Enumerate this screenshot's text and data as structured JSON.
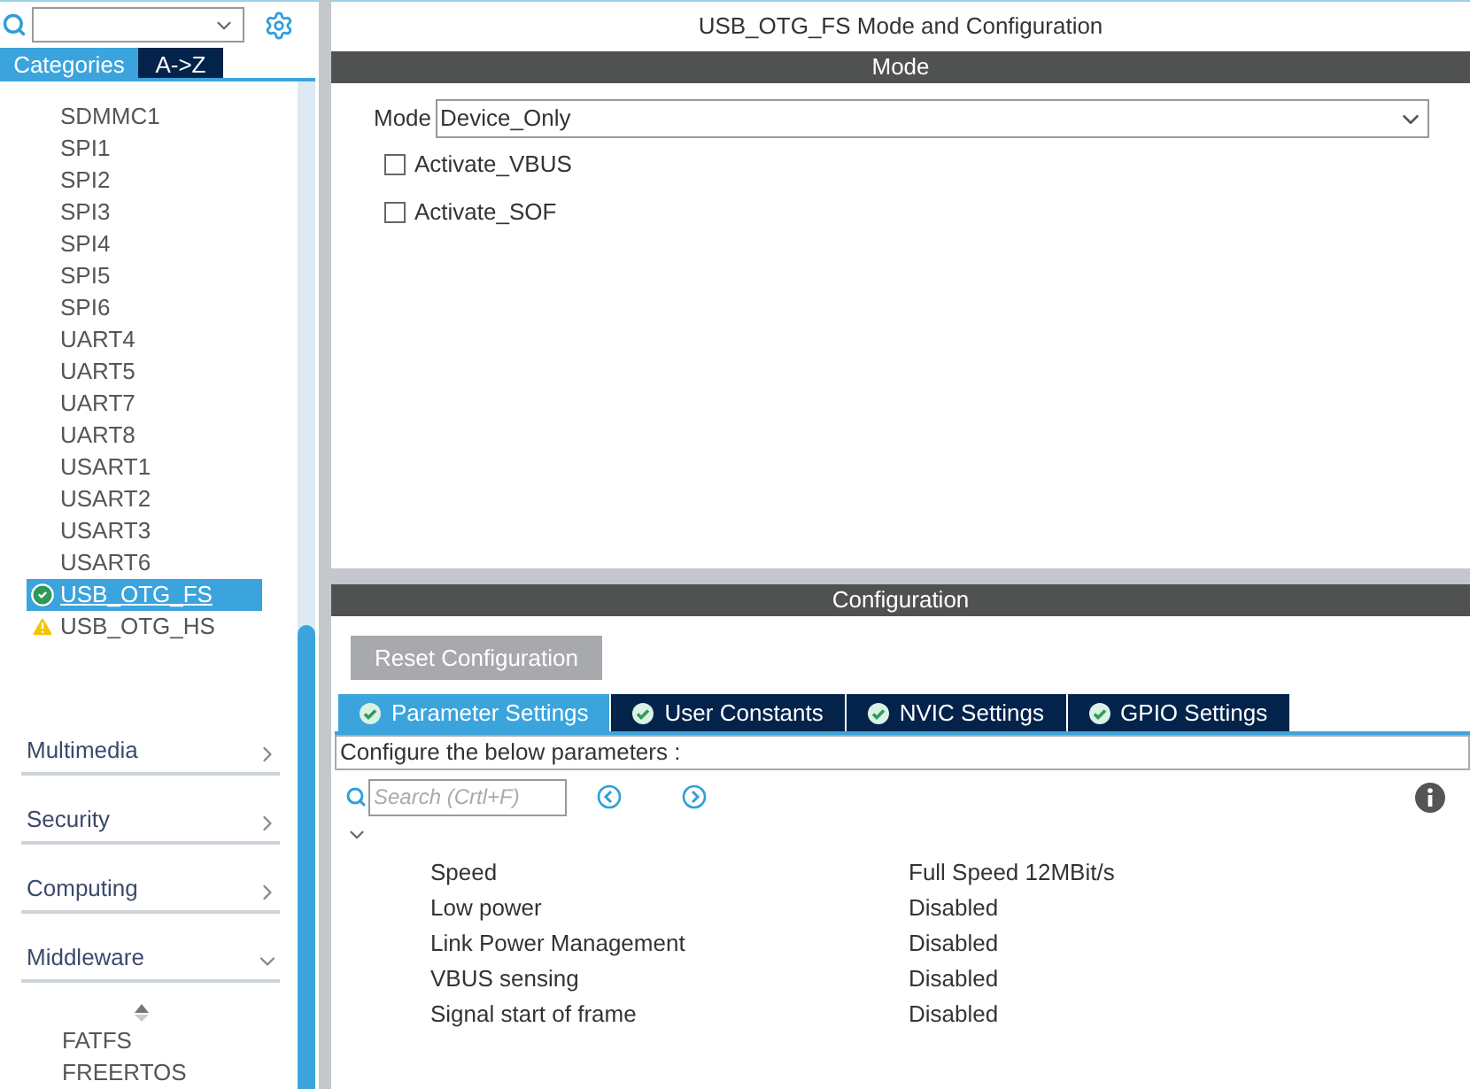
{
  "sidebar": {
    "view_tabs": [
      {
        "label": "Categories",
        "selected": true
      },
      {
        "label": "A->Z",
        "selected": false
      }
    ],
    "items": [
      {
        "label": "SDMMC1",
        "selected": false
      },
      {
        "label": "SPI1",
        "selected": false
      },
      {
        "label": "SPI2",
        "selected": false
      },
      {
        "label": "SPI3",
        "selected": false
      },
      {
        "label": "SPI4",
        "selected": false
      },
      {
        "label": "SPI5",
        "selected": false
      },
      {
        "label": "SPI6",
        "selected": false
      },
      {
        "label": "UART4",
        "selected": false
      },
      {
        "label": "UART5",
        "selected": false
      },
      {
        "label": "UART7",
        "selected": false
      },
      {
        "label": "UART8",
        "selected": false
      },
      {
        "label": "USART1",
        "selected": false
      },
      {
        "label": "USART2",
        "selected": false
      },
      {
        "label": "USART3",
        "selected": false
      },
      {
        "label": "USART6",
        "selected": false
      },
      {
        "label": "USB_OTG_FS",
        "kind": "ok",
        "selected": true
      },
      {
        "label": "USB_OTG_HS",
        "kind": "warning",
        "selected": false
      }
    ],
    "categories": [
      {
        "label": "Multimedia",
        "expanded": false
      },
      {
        "label": "Security",
        "expanded": false
      },
      {
        "label": "Computing",
        "expanded": false
      },
      {
        "label": "Middleware",
        "expanded": true
      }
    ],
    "middleware_items": [
      {
        "label": "FATFS"
      },
      {
        "label": "FREERTOS"
      }
    ]
  },
  "main": {
    "title": "USB_OTG_FS Mode and Configuration",
    "mode_section": {
      "header": "Mode",
      "mode_label": "Mode",
      "mode_value": "Device_Only",
      "options": [
        {
          "label": "Activate_VBUS",
          "checked": false
        },
        {
          "label": "Activate_SOF",
          "checked": false
        }
      ]
    },
    "config_section": {
      "header": "Configuration",
      "reset_button": "Reset Configuration",
      "tabs": [
        {
          "label": "Parameter Settings",
          "selected": true
        },
        {
          "label": "User Constants",
          "selected": false
        },
        {
          "label": "NVIC Settings",
          "selected": false
        },
        {
          "label": "GPIO Settings",
          "selected": false
        }
      ],
      "hint": "Configure the below parameters :",
      "search_placeholder": "Search (Crtl+F)",
      "parameters": [
        {
          "name": "Speed",
          "value": "Full Speed 12MBit/s"
        },
        {
          "name": "Low power",
          "value": "Disabled"
        },
        {
          "name": "Link Power Management",
          "value": "Disabled"
        },
        {
          "name": "VBUS sensing",
          "value": "Disabled"
        },
        {
          "name": "Signal start of frame",
          "value": "Disabled"
        }
      ]
    }
  }
}
